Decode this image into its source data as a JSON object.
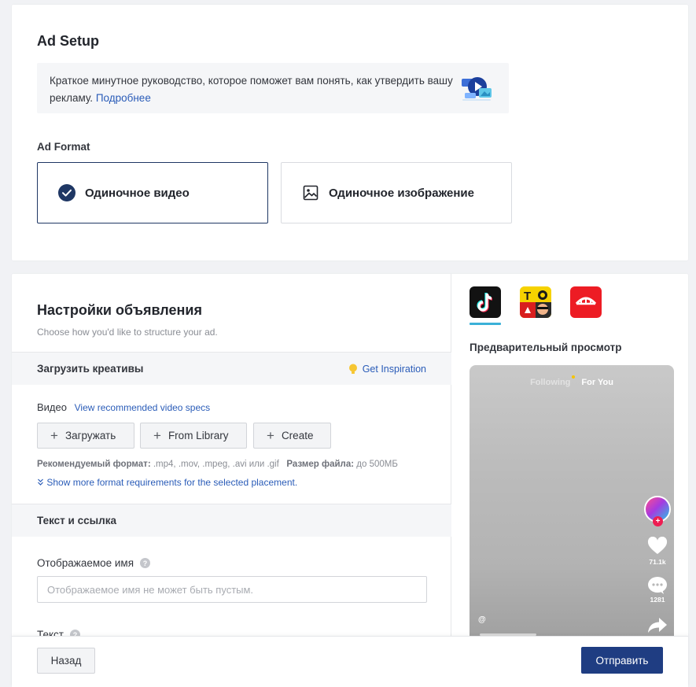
{
  "ad_setup": {
    "title": "Ad Setup",
    "guide_text": "Краткое минутное руководство, которое поможет вам понять, как утвердить вашу рекламу.",
    "guide_link": "Подробнее",
    "ad_format_label": "Ad Format",
    "formats": [
      {
        "label": "Одиночное видео",
        "selected": true,
        "icon": "check-circle-icon"
      },
      {
        "label": "Одиночное изображение",
        "selected": false,
        "icon": "image-icon"
      }
    ]
  },
  "ad_settings": {
    "title": "Настройки объявления",
    "subtitle": "Choose how you'd like to structure your ad.",
    "upload_section": {
      "title": "Загрузить креативы",
      "inspiration_link": "Get Inspiration"
    },
    "video_label": "Видео",
    "video_specs_link": "View recommended video specs",
    "buttons": {
      "upload": "Загружать",
      "library": "From Library",
      "create": "Create"
    },
    "format_info_label": "Рекомендуемый формат:",
    "format_info_value": ".mp4, .mov, .mpeg, .avi или .gif",
    "file_size_label": "Размер файла:",
    "file_size_value": "до 500МБ",
    "more_requirements_link": "Show more format requirements for the selected placement.",
    "text_link_section": {
      "title": "Текст и ссылка"
    },
    "display_name_label": "Отображаемое имя",
    "display_name_placeholder": "Отображаемое имя не может быть пустым.",
    "text_label": "Текст"
  },
  "preview": {
    "apps": [
      {
        "name": "TikTok",
        "icon": "tiktok-icon",
        "selected": true
      },
      {
        "name": "TopBuzz",
        "icon": "topbuzz-icon",
        "selected": false
      },
      {
        "name": "BaBe",
        "icon": "babe-icon",
        "selected": false
      }
    ],
    "title": "Предварительный просмотр",
    "phone": {
      "tab_following": "Following",
      "tab_for_you": "For You",
      "likes": "71.1k",
      "comments": "1281",
      "handle": "@"
    }
  },
  "footer": {
    "back_label": "Назад",
    "submit_label": "Отправить"
  },
  "colors": {
    "primary": "#1f3d82",
    "link": "#2a5cb8",
    "selected_border": "#1f3764",
    "tiktok_tab_underline": "#3bb1d8"
  }
}
